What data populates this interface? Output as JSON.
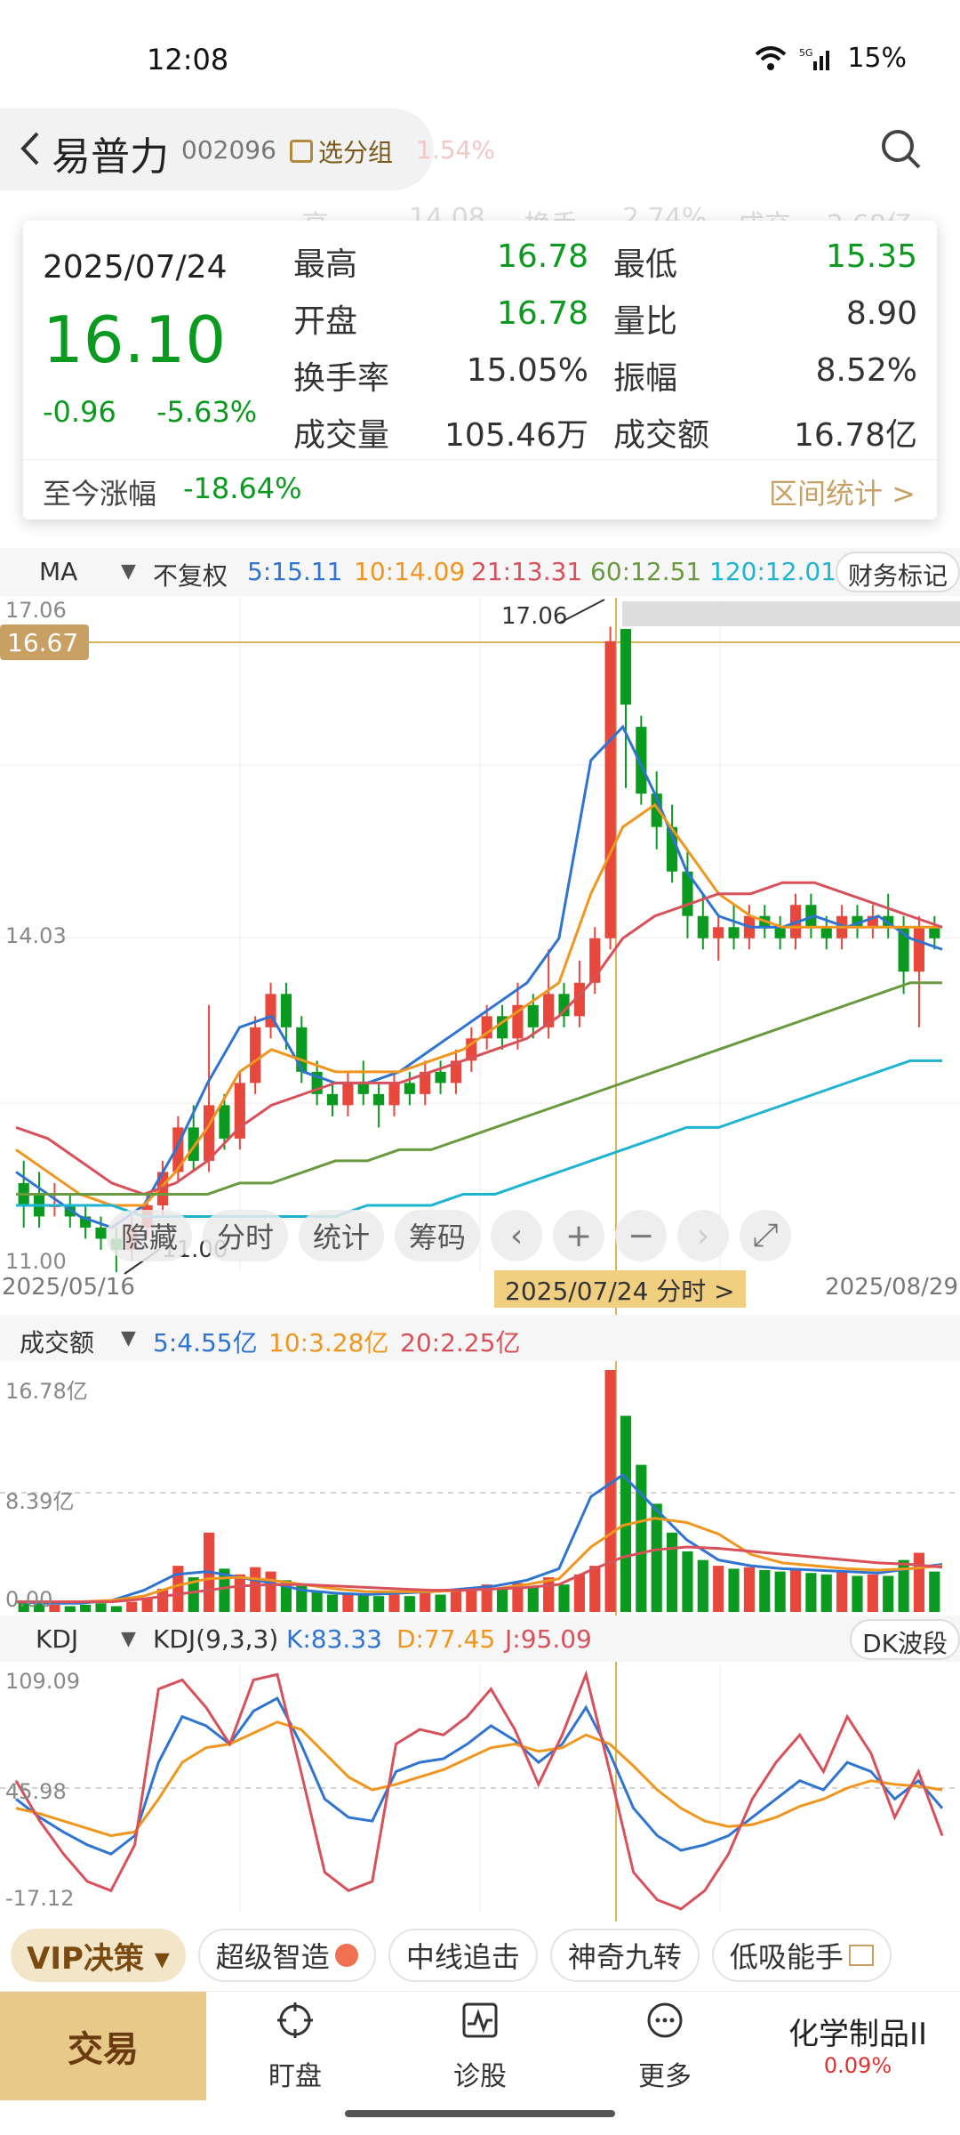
{
  "status": {
    "time": "12:08",
    "battery": "15%",
    "network": "5G"
  },
  "header": {
    "stock_name": "易普力",
    "stock_code": "002096",
    "add_group": "选分组",
    "faint_change": "1.54%"
  },
  "behind_bar": {
    "a": "高",
    "b": "14.08",
    "c": "换手",
    "d": "2.74%",
    "e": "成交",
    "f": "2.68亿"
  },
  "popup": {
    "date": "2025/07/24",
    "price": "16.10",
    "change": "-0.96",
    "change_pct": "-5.63%",
    "high_label": "最高",
    "high_value": "16.78",
    "low_label": "最低",
    "low_value": "15.35",
    "open_label": "开盘",
    "open_value": "16.78",
    "vol_ratio_label": "量比",
    "vol_ratio_value": "8.90",
    "turnover_label": "换手率",
    "turnover_value": "15.05%",
    "amplitude_label": "振幅",
    "amplitude_value": "8.52%",
    "volume_label": "成交量",
    "volume_value": "105.46万",
    "amount_label": "成交额",
    "amount_value": "16.78亿",
    "ytd_label": "至今涨幅",
    "ytd_value": "-18.64%",
    "stat_link": "区间统计 >"
  },
  "ma_bar": {
    "indicator": "MA",
    "adjust": "不复权",
    "ma5": "5:15.11",
    "ma10": "10:14.09",
    "ma21": "21:13.31",
    "ma60": "60:12.51",
    "ma120": "120:12.01",
    "fin_mark": "财务标记"
  },
  "main_chart": {
    "y_top": "17.06",
    "y_cursor": "16.67",
    "y_mid": "14.03",
    "y_bottom": "11.00",
    "high_annot": "17.06",
    "low_annot": "11.00"
  },
  "controls": {
    "hide": "隐藏",
    "intraday": "分时",
    "stats": "统计",
    "chips": "筹码"
  },
  "dates": {
    "start": "2025/05/16",
    "cursor": "2025/07/24 分时 >",
    "end": "2025/08/29"
  },
  "vol_bar": {
    "indicator": "成交额",
    "v5": "5:4.55亿",
    "v10": "10:3.28亿",
    "v20": "20:2.25亿"
  },
  "vol_chart": {
    "y_top": "16.78亿",
    "y_mid": "8.39亿",
    "y_bottom": "0.00"
  },
  "kdj_bar": {
    "indicator": "KDJ",
    "params": "KDJ(9,3,3)",
    "k": "K:83.33",
    "d": "D:77.45",
    "j": "J:95.09",
    "dk": "DK波段"
  },
  "kdj_chart": {
    "y_top": "109.09",
    "y_mid": "45.98",
    "y_bottom": "-17.12"
  },
  "strategy": {
    "vip": "VIP决策 ▾",
    "s1": "超级智造",
    "s2": "中线追击",
    "s3": "神奇九转",
    "s4": "低吸能手"
  },
  "nav": {
    "trade": "交易",
    "watch": "盯盘",
    "diag": "诊股",
    "more": "更多",
    "sector": "化学制品II",
    "sector_pct": "0.09%"
  },
  "colors": {
    "up": "#e8473c",
    "down": "#0a9a1f",
    "ma5": "#2f74d0",
    "ma10": "#f0961e",
    "ma21": "#d8505a",
    "ma60": "#6a9a40",
    "ma120": "#1fb4d0",
    "accent": "#c9a064"
  },
  "chart_data": [
    {
      "type": "candlestick",
      "title": "",
      "x_range": [
        "2025/05/16",
        "2025/08/29"
      ],
      "ylim": [
        11.0,
        17.06
      ],
      "series": [
        {
          "name": "MA5",
          "last": 15.11
        },
        {
          "name": "MA10",
          "last": 14.09
        },
        {
          "name": "MA21",
          "last": 13.31
        },
        {
          "name": "MA60",
          "last": 12.51
        },
        {
          "name": "MA120",
          "last": 12.01
        }
      ],
      "selected": {
        "date": "2025/07/24",
        "open": 16.78,
        "high": 16.78,
        "low": 15.35,
        "close": 16.1
      }
    },
    {
      "type": "bar",
      "title": "",
      "ylim": [
        0,
        16.78
      ],
      "series": [
        {
          "name": "5",
          "last": 4.55
        },
        {
          "name": "10",
          "last": 3.28
        },
        {
          "name": "20",
          "last": 2.25
        }
      ]
    },
    {
      "type": "line",
      "title": "",
      "ylim": [
        -17.12,
        109.09
      ],
      "series": [
        {
          "name": "K",
          "last": 83.33
        },
        {
          "name": "D",
          "last": 77.45
        },
        {
          "name": "J",
          "last": 95.09
        }
      ]
    }
  ]
}
